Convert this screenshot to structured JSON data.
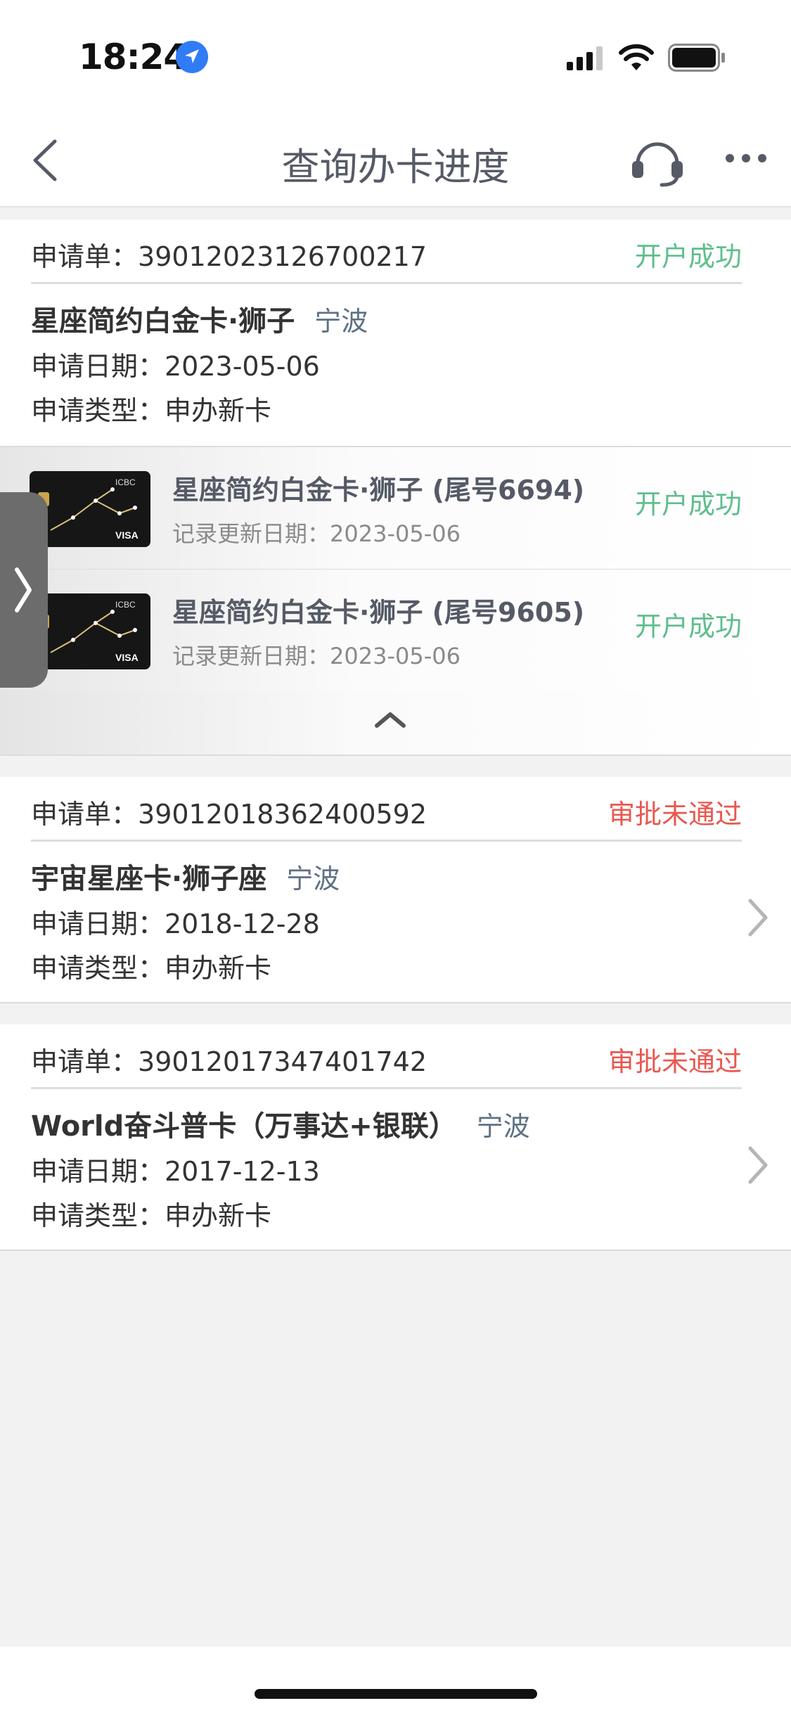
{
  "status_bar": {
    "time": "18:24"
  },
  "nav": {
    "title": "查询办卡进度"
  },
  "colors": {
    "success": "#5fbe8d",
    "failure": "#e8584f",
    "city": "#5e7184"
  },
  "icons": [
    "location-arrow-icon",
    "signal-icon",
    "wifi-icon",
    "battery-icon",
    "back-icon",
    "customer-service-icon",
    "more-icon",
    "chevron-up-icon",
    "chevron-right-icon",
    "side-expand-icon"
  ],
  "applications": [
    {
      "label": "申请单：",
      "number": "39012023126700217",
      "status": "开户成功",
      "card_name": "星座简约白金卡·狮子",
      "city": "宁波",
      "date_line": "申请日期：2023-05-06",
      "type_line": "申请类型：申办新卡",
      "cards": [
        {
          "title": "星座简约白金卡·狮子 (尾号6694)",
          "updated": "记录更新日期：2023-05-06",
          "status": "开户成功",
          "brand": "ICBC",
          "network": "VISA"
        },
        {
          "title": "星座简约白金卡·狮子 (尾号9605)",
          "updated": "记录更新日期：2023-05-06",
          "status": "开户成功",
          "brand": "ICBC",
          "network": "VISA"
        }
      ]
    },
    {
      "label": "申请单：",
      "number": "39012018362400592",
      "status": "审批未通过",
      "card_name": "宇宙星座卡·狮子座",
      "city": "宁波",
      "date_line": "申请日期：2018-12-28",
      "type_line": "申请类型：申办新卡"
    },
    {
      "label": "申请单：",
      "number": "39012017347401742",
      "status": "审批未通过",
      "card_name": "World奋斗普卡（万事达+银联）",
      "city": "宁波",
      "date_line": "申请日期：2017-12-13",
      "type_line": "申请类型：申办新卡"
    }
  ]
}
